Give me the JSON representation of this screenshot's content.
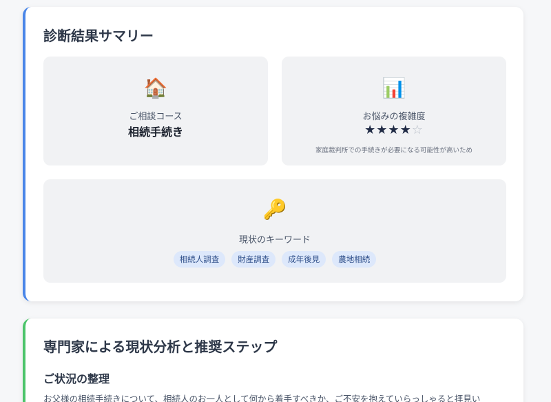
{
  "summary": {
    "title": "診断結果サマリー",
    "course": {
      "icon": "house-icon",
      "icon_glyph": "🏠",
      "label": "ご相談コース",
      "value": "相続手続き"
    },
    "complexity": {
      "icon": "bar-chart-icon",
      "icon_glyph": "📊",
      "label": "お悩みの複雑度",
      "rating": 4,
      "max": 5,
      "stars_filled": "★★★★",
      "stars_empty": "☆",
      "note": "家庭裁判所での手続きが必要になる可能性が高いため"
    },
    "keywords": {
      "icon": "key-icon",
      "icon_glyph": "🔑",
      "label": "現状のキーワード",
      "tags": [
        "相続人調査",
        "財産調査",
        "成年後見",
        "農地相続"
      ]
    }
  },
  "analysis": {
    "title": "専門家による現状分析と推奨ステップ",
    "section_heading": "ご状況の整理",
    "section_text": "お父様の相続手続きについて、相続人のお一人として何から着手すべきか、ご不安を抱えていらっしゃると拝見い"
  },
  "colors": {
    "summary_accent": "#4a86e8",
    "analysis_accent": "#4cc46a",
    "tag_bg": "#dde8fb",
    "tag_text": "#2f4f8a"
  }
}
